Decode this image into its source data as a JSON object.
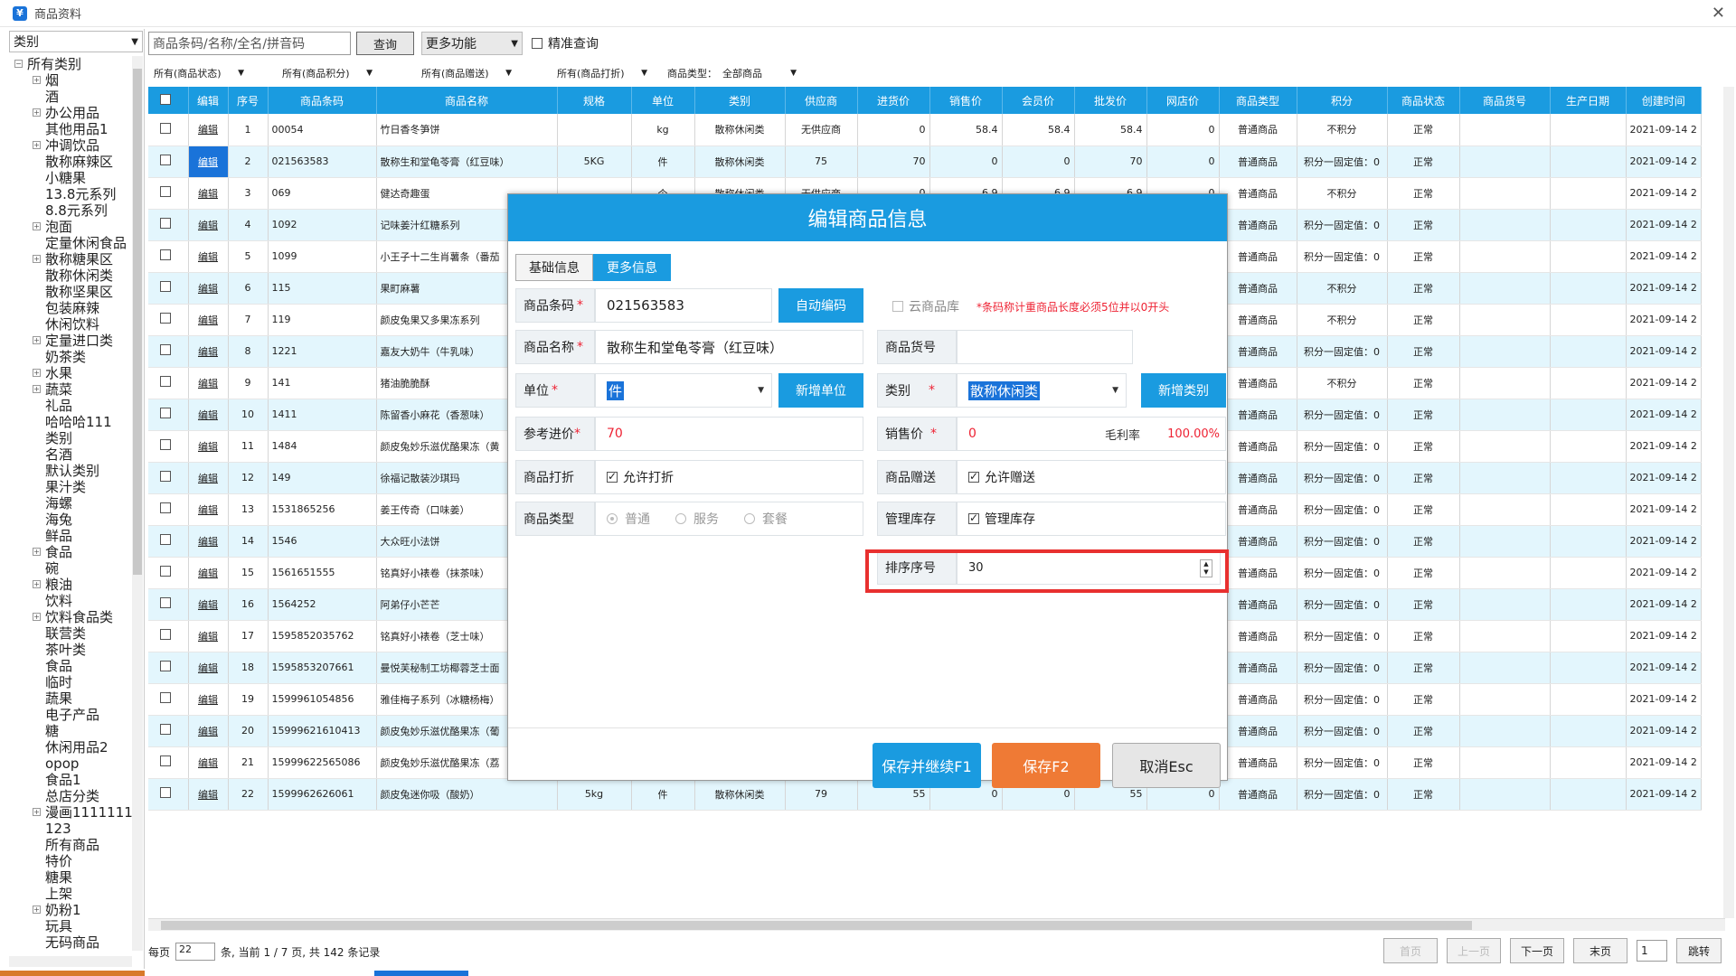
{
  "window": {
    "title": "商品资料",
    "close": "✕"
  },
  "left": {
    "category_label": "类别",
    "tree_root": "所有类别",
    "tree": [
      {
        "label": "烟",
        "exp": true
      },
      {
        "label": "酒",
        "exp": false
      },
      {
        "label": "办公用品",
        "exp": true
      },
      {
        "label": "其他用品1",
        "exp": false
      },
      {
        "label": "冲调饮品",
        "exp": true
      },
      {
        "label": "散称麻辣区",
        "exp": false
      },
      {
        "label": "小糖果",
        "exp": false
      },
      {
        "label": "13.8元系列",
        "exp": false
      },
      {
        "label": "8.8元系列",
        "exp": false
      },
      {
        "label": "泡面",
        "exp": true
      },
      {
        "label": "定量休闲食品",
        "exp": false
      },
      {
        "label": "散称糖果区",
        "exp": true
      },
      {
        "label": "散称休闲类",
        "exp": false
      },
      {
        "label": "散称坚果区",
        "exp": false
      },
      {
        "label": "包装麻辣",
        "exp": false
      },
      {
        "label": "休闲饮料",
        "exp": false
      },
      {
        "label": "定量进口类",
        "exp": true
      },
      {
        "label": "奶茶类",
        "exp": false
      },
      {
        "label": "水果",
        "exp": true
      },
      {
        "label": "蔬菜",
        "exp": true
      },
      {
        "label": "礼品",
        "exp": false
      },
      {
        "label": "哈哈哈111",
        "exp": false
      },
      {
        "label": "类别",
        "exp": false
      },
      {
        "label": "名酒",
        "exp": false
      },
      {
        "label": "默认类别",
        "exp": false
      },
      {
        "label": "果汁类",
        "exp": false
      },
      {
        "label": "海螺",
        "exp": false
      },
      {
        "label": "海兔",
        "exp": false
      },
      {
        "label": "鲜品",
        "exp": false
      },
      {
        "label": "食品",
        "exp": true
      },
      {
        "label": "碗",
        "exp": false
      },
      {
        "label": "粮油",
        "exp": true
      },
      {
        "label": "饮料",
        "exp": false
      },
      {
        "label": "饮料食品类",
        "exp": true
      },
      {
        "label": "联营类",
        "exp": false
      },
      {
        "label": "茶叶类",
        "exp": false
      },
      {
        "label": "食品",
        "exp": false
      },
      {
        "label": "临时",
        "exp": false
      },
      {
        "label": "蔬果",
        "exp": false
      },
      {
        "label": "电子产品",
        "exp": false
      },
      {
        "label": "糖",
        "exp": false
      },
      {
        "label": "休闲用品2",
        "exp": false
      },
      {
        "label": "opop",
        "exp": false
      },
      {
        "label": "食品1",
        "exp": false
      },
      {
        "label": "总店分类",
        "exp": false
      },
      {
        "label": "漫画1111111",
        "exp": true
      },
      {
        "label": "123",
        "exp": false
      },
      {
        "label": "所有商品",
        "exp": false
      },
      {
        "label": "特价",
        "exp": false
      },
      {
        "label": "糖果",
        "exp": false
      },
      {
        "label": "上架",
        "exp": false
      },
      {
        "label": "奶粉1",
        "exp": true
      },
      {
        "label": "玩具",
        "exp": false
      },
      {
        "label": "无码商品",
        "exp": false
      }
    ]
  },
  "toolbar": {
    "search_placeholder": "商品条码/名称/全名/拼音码",
    "query": "查询",
    "more": "更多功能",
    "exact": "精准查询"
  },
  "filters": {
    "status": "所有(商品状态)",
    "points": "所有(商品积分)",
    "gift": "所有(商品赠送)",
    "print": "所有(商品打折)",
    "type_label": "商品类型：",
    "type_value": "全部商品"
  },
  "columns": [
    "",
    "编辑",
    "序号",
    "商品条码",
    "商品名称",
    "规格",
    "单位",
    "类别",
    "供应商",
    "进货价",
    "销售价",
    "会员价",
    "批发价",
    "网店价",
    "商品类型",
    "积分",
    "商品状态",
    "商品货号",
    "生产日期",
    "创建时间"
  ],
  "rows": [
    {
      "seq": "1",
      "code": "00054",
      "name": "竹日香冬笋饼",
      "spec": "",
      "unit": "kg",
      "cat": "散称休闲类",
      "sup": "无供应商",
      "in": "0",
      "sale": "58.4",
      "member": "58.4",
      "whole": "58.4",
      "online": "0",
      "type": "普通商品",
      "pts": "不积分",
      "status": "正常",
      "created": "2021-09-14 2"
    },
    {
      "seq": "2",
      "code": "021563583",
      "name": "散称生和堂龟苓膏（红豆味）",
      "spec": "5KG",
      "unit": "件",
      "cat": "散称休闲类",
      "sup": "75",
      "in": "70",
      "sale": "0",
      "member": "0",
      "whole": "70",
      "online": "0",
      "type": "普通商品",
      "pts": "积分一固定值：0",
      "status": "正常",
      "created": "2021-09-14 2"
    },
    {
      "seq": "3",
      "code": "069",
      "name": "健达奇趣蛋",
      "spec": "",
      "unit": "个",
      "cat": "散称休闲类",
      "sup": "无供应商",
      "in": "0",
      "sale": "6.9",
      "member": "6.9",
      "whole": "6.9",
      "online": "0",
      "type": "普通商品",
      "pts": "不积分",
      "status": "正常",
      "created": "2021-09-14 2"
    },
    {
      "seq": "4",
      "code": "1092",
      "name": "记味姜汁红糖系列",
      "spec": "",
      "unit": "",
      "cat": "",
      "sup": "",
      "in": "",
      "sale": "",
      "member": "",
      "whole": "",
      "online": "0",
      "type": "普通商品",
      "pts": "积分一固定值：0",
      "status": "正常",
      "created": "2021-09-14 2"
    },
    {
      "seq": "5",
      "code": "1099",
      "name": "小王子十二生肖薯条（番茄",
      "spec": "",
      "unit": "",
      "cat": "",
      "sup": "",
      "in": "",
      "sale": "",
      "member": "",
      "whole": "",
      "online": "0",
      "type": "普通商品",
      "pts": "积分一固定值：0",
      "status": "正常",
      "created": "2021-09-14 2"
    },
    {
      "seq": "6",
      "code": "115",
      "name": "果町麻薯",
      "spec": "",
      "unit": "",
      "cat": "",
      "sup": "",
      "in": "",
      "sale": "",
      "member": "",
      "whole": "",
      "online": "0",
      "type": "普通商品",
      "pts": "不积分",
      "status": "正常",
      "created": "2021-09-14 2"
    },
    {
      "seq": "7",
      "code": "119",
      "name": "颜皮兔果又多果冻系列",
      "spec": "",
      "unit": "",
      "cat": "",
      "sup": "",
      "in": "",
      "sale": "",
      "member": "",
      "whole": "",
      "online": "0",
      "type": "普通商品",
      "pts": "不积分",
      "status": "正常",
      "created": "2021-09-14 2"
    },
    {
      "seq": "8",
      "code": "1221",
      "name": "嘉友大奶牛（牛乳味）",
      "spec": "",
      "unit": "",
      "cat": "",
      "sup": "",
      "in": "",
      "sale": "",
      "member": "",
      "whole": "",
      "online": "0",
      "type": "普通商品",
      "pts": "积分一固定值：0",
      "status": "正常",
      "created": "2021-09-14 2"
    },
    {
      "seq": "9",
      "code": "141",
      "name": "猪油脆脆酥",
      "spec": "",
      "unit": "",
      "cat": "",
      "sup": "",
      "in": "",
      "sale": "",
      "member": "",
      "whole": "",
      "online": "0",
      "type": "普通商品",
      "pts": "不积分",
      "status": "正常",
      "created": "2021-09-14 2"
    },
    {
      "seq": "10",
      "code": "1411",
      "name": "陈留香小麻花（香葱味）",
      "spec": "",
      "unit": "",
      "cat": "",
      "sup": "",
      "in": "",
      "sale": "",
      "member": "",
      "whole": "",
      "online": "0",
      "type": "普通商品",
      "pts": "积分一固定值：0",
      "status": "正常",
      "created": "2021-09-14 2"
    },
    {
      "seq": "11",
      "code": "1484",
      "name": "颜皮兔妙乐滋优酪果冻（黄",
      "spec": "",
      "unit": "",
      "cat": "",
      "sup": "",
      "in": "",
      "sale": "",
      "member": "",
      "whole": "",
      "online": "0",
      "type": "普通商品",
      "pts": "积分一固定值：0",
      "status": "正常",
      "created": "2021-09-14 2"
    },
    {
      "seq": "12",
      "code": "149",
      "name": "徐福记散装沙琪玛",
      "spec": "",
      "unit": "",
      "cat": "",
      "sup": "",
      "in": "",
      "sale": "",
      "member": "",
      "whole": "",
      "online": "0",
      "type": "普通商品",
      "pts": "积分一固定值：0",
      "status": "正常",
      "created": "2021-09-14 2"
    },
    {
      "seq": "13",
      "code": "1531865256",
      "name": "姜王传奇（口味姜）",
      "spec": "",
      "unit": "",
      "cat": "",
      "sup": "",
      "in": "",
      "sale": "",
      "member": "",
      "whole": "",
      "online": "0",
      "type": "普通商品",
      "pts": "积分一固定值：0",
      "status": "正常",
      "created": "2021-09-14 2"
    },
    {
      "seq": "14",
      "code": "1546",
      "name": "大众旺小法饼",
      "spec": "",
      "unit": "",
      "cat": "",
      "sup": "",
      "in": "",
      "sale": "",
      "member": "",
      "whole": "",
      "online": "0",
      "type": "普通商品",
      "pts": "积分一固定值：0",
      "status": "正常",
      "created": "2021-09-14 2"
    },
    {
      "seq": "15",
      "code": "1561651555",
      "name": "铭真好小裱卷（抹茶味）",
      "spec": "",
      "unit": "",
      "cat": "",
      "sup": "",
      "in": "",
      "sale": "",
      "member": "",
      "whole": "",
      "online": "0",
      "type": "普通商品",
      "pts": "积分一固定值：0",
      "status": "正常",
      "created": "2021-09-14 2"
    },
    {
      "seq": "16",
      "code": "1564252",
      "name": "阿弟仔小芒芒",
      "spec": "",
      "unit": "",
      "cat": "",
      "sup": "",
      "in": "",
      "sale": "",
      "member": "",
      "whole": "",
      "online": "0",
      "type": "普通商品",
      "pts": "积分一固定值：0",
      "status": "正常",
      "created": "2021-09-14 2"
    },
    {
      "seq": "17",
      "code": "1595852035762",
      "name": "铭真好小裱卷（芝士味）",
      "spec": "",
      "unit": "",
      "cat": "",
      "sup": "",
      "in": "",
      "sale": "",
      "member": "",
      "whole": "",
      "online": "0",
      "type": "普通商品",
      "pts": "积分一固定值：0",
      "status": "正常",
      "created": "2021-09-14 2"
    },
    {
      "seq": "18",
      "code": "1595853207661",
      "name": "曼悦芙秘制工坊椰蓉芝士面",
      "spec": "",
      "unit": "",
      "cat": "",
      "sup": "",
      "in": "",
      "sale": "",
      "member": "",
      "whole": "",
      "online": "0",
      "type": "普通商品",
      "pts": "积分一固定值：0",
      "status": "正常",
      "created": "2021-09-14 2"
    },
    {
      "seq": "19",
      "code": "1599961054856",
      "name": "雅佳梅子系列（冰糖杨梅）",
      "spec": "",
      "unit": "",
      "cat": "",
      "sup": "",
      "in": "",
      "sale": "",
      "member": "",
      "whole": "",
      "online": "0",
      "type": "普通商品",
      "pts": "积分一固定值：0",
      "status": "正常",
      "created": "2021-09-14 2"
    },
    {
      "seq": "20",
      "code": "15999621610413",
      "name": "颜皮兔妙乐滋优酪果冻（葡",
      "spec": "",
      "unit": "",
      "cat": "",
      "sup": "",
      "in": "",
      "sale": "",
      "member": "",
      "whole": "",
      "online": "0",
      "type": "普通商品",
      "pts": "积分一固定值：0",
      "status": "正常",
      "created": "2021-09-14 2"
    },
    {
      "seq": "21",
      "code": "15999622565086",
      "name": "颜皮兔妙乐滋优酪果冻（荔",
      "spec": "",
      "unit": "",
      "cat": "",
      "sup": "",
      "in": "",
      "sale": "",
      "member": "",
      "whole": "",
      "online": "0",
      "type": "普通商品",
      "pts": "积分一固定值：0",
      "status": "正常",
      "created": "2021-09-14 2"
    },
    {
      "seq": "22",
      "code": "1599962626061",
      "name": "颜皮兔迷你吸（酸奶）",
      "spec": "5kg",
      "unit": "件",
      "cat": "散称休闲类",
      "sup": "79",
      "in": "55",
      "sale": "0",
      "member": "0",
      "whole": "55",
      "online": "0",
      "type": "普通商品",
      "pts": "积分一固定值：0",
      "status": "正常",
      "created": "2021-09-14 2"
    }
  ],
  "edit_label": "编辑",
  "status": {
    "per_page_label": "每页",
    "per_page_value": "22",
    "summary": "条, 当前 1 / 7 页, 共 142 条记录"
  },
  "pager": {
    "first": "首页",
    "prev": "上一页",
    "next": "下一页",
    "last": "末页",
    "jump_value": "1",
    "jump": "跳转"
  },
  "modal": {
    "title": "编辑商品信息",
    "tab_basic": "基础信息",
    "tab_more": "更多信息",
    "barcode_label": "商品条码",
    "barcode_value": "021563583",
    "auto_code": "自动编码",
    "cloud_lib": "云商品库",
    "cloud_hint": "*条码称计重商品长度必须5位并以0开头",
    "name_label": "商品名称",
    "name_value": "散称生和堂龟苓膏（红豆味）",
    "sku_label": "商品货号",
    "unit_label": "单位",
    "unit_value": "件",
    "add_unit": "新增单位",
    "category_label": "类别",
    "category_value": "散称休闲类",
    "add_category": "新增类别",
    "cost_label": "参考进价",
    "cost_value": "70",
    "price_label": "销售价",
    "price_value": "0",
    "margin_label": "毛利率",
    "margin_value": "100.00%",
    "print_label": "商品打折",
    "print_check": "允许打折",
    "gift_label": "商品赠送",
    "gift_check": "允许赠送",
    "type_label": "商品类型",
    "type_opt1": "普通",
    "type_opt2": "服务",
    "type_opt3": "套餐",
    "stock_label": "管理库存",
    "stock_check": "管理库存",
    "sort_label": "排序序号",
    "sort_value": "30",
    "save_continue": "保存并继续F1",
    "save": "保存F2",
    "cancel": "取消Esc",
    "colors": {
      "header": "#1a9be0",
      "save": "#ef7a35",
      "highlight": "#e8302f"
    }
  }
}
